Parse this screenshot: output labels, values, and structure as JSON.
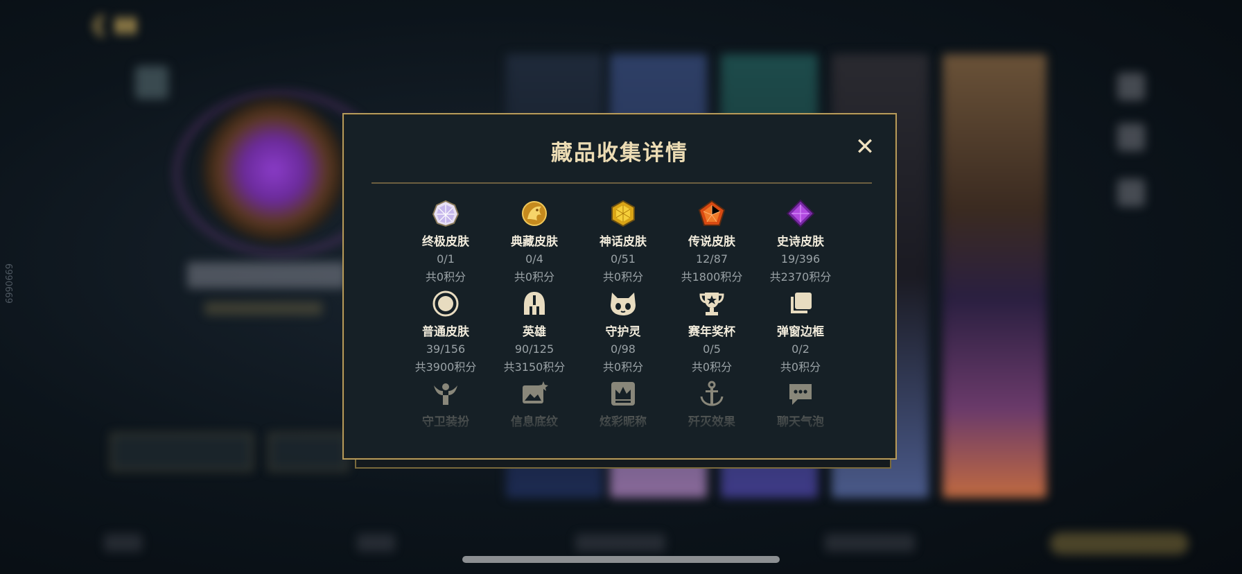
{
  "dialog": {
    "title": "藏品收集详情",
    "close_symbol": "✕"
  },
  "categories": [
    {
      "label": "终极皮肤",
      "count": "0/1",
      "points": "共0积分",
      "icon": "ultimate-skin-icon"
    },
    {
      "label": "典藏皮肤",
      "count": "0/4",
      "points": "共0积分",
      "icon": "prestige-skin-icon"
    },
    {
      "label": "神话皮肤",
      "count": "0/51",
      "points": "共0积分",
      "icon": "mythic-skin-icon"
    },
    {
      "label": "传说皮肤",
      "count": "12/87",
      "points": "共1800积分",
      "icon": "legendary-skin-icon"
    },
    {
      "label": "史诗皮肤",
      "count": "19/396",
      "points": "共2370积分",
      "icon": "epic-skin-icon"
    },
    {
      "label": "普通皮肤",
      "count": "39/156",
      "points": "共3900积分",
      "icon": "standard-skin-icon"
    },
    {
      "label": "英雄",
      "count": "90/125",
      "points": "共3150积分",
      "icon": "champion-helmet-icon"
    },
    {
      "label": "守护灵",
      "count": "0/98",
      "points": "共0积分",
      "icon": "guardian-pet-icon"
    },
    {
      "label": "赛年奖杯",
      "count": "0/5",
      "points": "共0积分",
      "icon": "season-trophy-icon"
    },
    {
      "label": "弹窗边框",
      "count": "0/2",
      "points": "共0积分",
      "icon": "popup-frame-icon"
    },
    {
      "label": "守卫装扮",
      "icon": "ward-skin-icon"
    },
    {
      "label": "信息底纹",
      "icon": "info-banner-icon"
    },
    {
      "label": "炫彩昵称",
      "icon": "colorful-nickname-icon"
    },
    {
      "label": "歼灭效果",
      "icon": "ace-effect-icon"
    },
    {
      "label": "聊天气泡",
      "icon": "chat-bubble-icon"
    }
  ],
  "background": {
    "side_code": "6990669"
  },
  "colors": {
    "accent_gold": "#b59b5c",
    "title": "#ecdcb4",
    "panel": "#162026"
  }
}
